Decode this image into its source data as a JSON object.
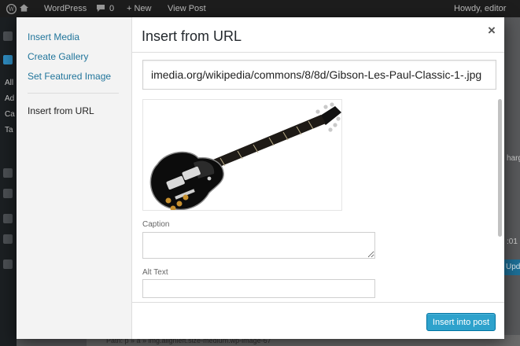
{
  "adminbar": {
    "site_name": "WordPress",
    "comments_count": "0",
    "new_label": "+ New",
    "view_post_label": "View Post",
    "greeting": "Howdy, editor"
  },
  "background": {
    "sidebar_fragments": [
      "All",
      "Ad",
      "Ca",
      "Ta"
    ],
    "right_fragments": [
      "harg",
      ":01",
      "Upd"
    ],
    "status_path": "Path: p » a » img.alignleft.size-medium.wp-image-67"
  },
  "media_menu": {
    "items": [
      {
        "label": "Insert Media"
      },
      {
        "label": "Create Gallery"
      },
      {
        "label": "Set Featured Image"
      },
      {
        "label": "Insert from URL"
      }
    ]
  },
  "frame": {
    "title": "Insert from URL",
    "close_glyph": "×"
  },
  "embed": {
    "url_value": "imedia.org/wikipedia/commons/8/8d/Gibson-Les-Paul-Classic-1-.jpg",
    "caption_label": "Caption",
    "caption_value": "",
    "alt_label": "Alt Text",
    "alt_value": ""
  },
  "toolbar": {
    "insert_label": "Insert into post"
  },
  "colors": {
    "accent": "#2ea2cc",
    "link": "#21759b",
    "menu_bg": "#f3f3f3",
    "overlay_bg": "#58595b"
  }
}
